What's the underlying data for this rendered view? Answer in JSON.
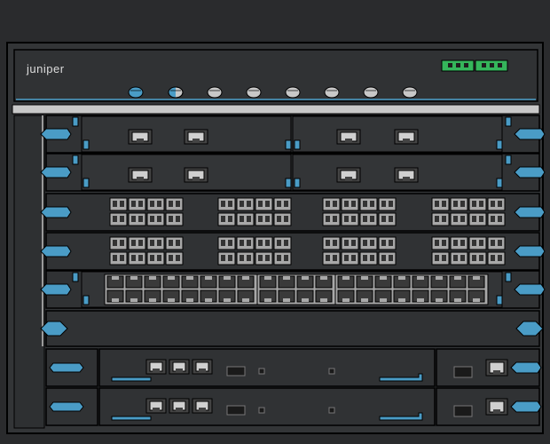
{
  "brand": {
    "logo_text": "juniper"
  },
  "colors": {
    "background": "#1e1e1e",
    "chassis": "#333537",
    "chassis_dark": "#2a2b2d",
    "outline": "#000000",
    "accent_blue": "#4a9cc6",
    "led_green": "#35b65b",
    "port_grey": "#a8a8a8",
    "rail_grey": "#c8c8c8"
  },
  "front_panel": {
    "status_indicators": [
      "blue",
      "half",
      "grey",
      "grey",
      "grey",
      "grey",
      "grey",
      "grey"
    ],
    "connector_blocks": 2
  },
  "line_cards": [
    {
      "type": "dual-module-rj45-pair"
    },
    {
      "type": "dual-module-rj45-pair"
    },
    {
      "type": "sfp-quad-blocks"
    },
    {
      "type": "sfp-quad-blocks"
    },
    {
      "type": "rj45-48port"
    },
    {
      "type": "blank-filler"
    },
    {
      "type": "routing-engine"
    },
    {
      "type": "routing-engine"
    }
  ]
}
